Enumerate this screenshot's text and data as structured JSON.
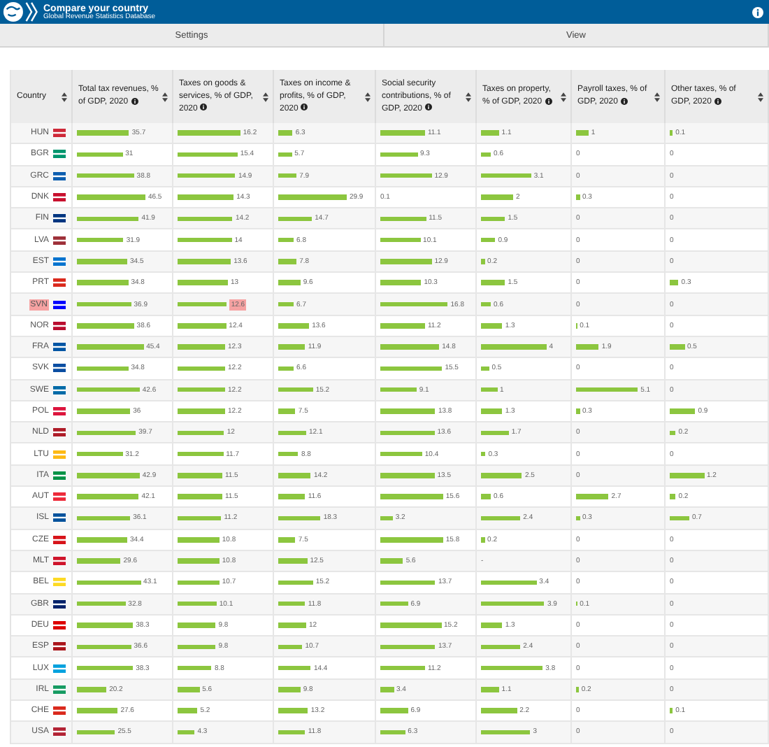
{
  "header": {
    "title": "Compare your country",
    "subtitle": "Global Revenue Statistics Database"
  },
  "tabs": [
    {
      "label": "Settings",
      "selected": false
    },
    {
      "label": "View",
      "selected": false
    }
  ],
  "table": {
    "columns": [
      {
        "label": "Country",
        "info": false
      },
      {
        "label": "Total tax revenues, % of GDP, 2020",
        "info": true
      },
      {
        "label": "Taxes on goods & services, % of GDP, 2020",
        "info": true
      },
      {
        "label": "Taxes on income & profits, % of GDP, 2020",
        "info": true
      },
      {
        "label": "Social security contributions, % of GDP, 2020",
        "info": true
      },
      {
        "label": "Taxes on property, % of GDP, 2020",
        "info": true
      },
      {
        "label": "Payroll taxes, % of GDP, 2020",
        "info": true
      },
      {
        "label": "Other taxes, % of GDP, 2020",
        "info": true
      }
    ],
    "rows": [
      {
        "cells": [
          {
            "kind": "country",
            "value": "HUN",
            "highlighted": false,
            "color": "#ce2939"
          },
          {
            "kind": "bar",
            "value": "35.7",
            "level": 0.55
          },
          {
            "kind": "bar",
            "value": "16.2",
            "level": 0.66
          },
          {
            "kind": "bar",
            "value": "6.3",
            "level": 0.15
          },
          {
            "kind": "bar",
            "value": "11.1",
            "level": 0.47
          },
          {
            "kind": "bar",
            "value": "1.1",
            "level": 0.2
          },
          {
            "kind": "bar",
            "value": "1",
            "level": 0.14
          },
          {
            "kind": "bar",
            "value": "0.1",
            "level": 0.03
          }
        ]
      },
      {
        "cells": [
          {
            "kind": "country",
            "value": "BGR",
            "highlighted": false,
            "color": "#00966e"
          },
          {
            "kind": "bar",
            "value": "31",
            "level": 0.48
          },
          {
            "kind": "bar",
            "value": "15.4",
            "level": 0.63
          },
          {
            "kind": "bar",
            "value": "5.7",
            "level": 0.14
          },
          {
            "kind": "bar",
            "value": "9.3",
            "level": 0.39
          },
          {
            "kind": "bar",
            "value": "0.6",
            "level": 0.11
          },
          {
            "kind": "bar",
            "value": "0",
            "level": 0
          },
          {
            "kind": "bar",
            "value": "0",
            "level": 0
          }
        ]
      },
      {
        "cells": [
          {
            "kind": "country",
            "value": "GRC",
            "highlighted": false,
            "color": "#0d5eaf"
          },
          {
            "kind": "bar",
            "value": "38.8",
            "level": 0.6
          },
          {
            "kind": "bar",
            "value": "14.9",
            "level": 0.61
          },
          {
            "kind": "bar",
            "value": "7.9",
            "level": 0.19
          },
          {
            "kind": "bar",
            "value": "12.9",
            "level": 0.54
          },
          {
            "kind": "bar",
            "value": "3.1",
            "level": 0.56
          },
          {
            "kind": "bar",
            "value": "0",
            "level": 0
          },
          {
            "kind": "bar",
            "value": "0",
            "level": 0
          }
        ]
      },
      {
        "cells": [
          {
            "kind": "country",
            "value": "DNK",
            "highlighted": false,
            "color": "#c8102e"
          },
          {
            "kind": "bar",
            "value": "46.5",
            "level": 0.72
          },
          {
            "kind": "bar",
            "value": "14.3",
            "level": 0.59
          },
          {
            "kind": "bar",
            "value": "29.9",
            "level": 0.71
          },
          {
            "kind": "bar",
            "value": "0.1",
            "level": 0
          },
          {
            "kind": "bar",
            "value": "2",
            "level": 0.36
          },
          {
            "kind": "bar",
            "value": "0.3",
            "level": 0.04
          },
          {
            "kind": "bar",
            "value": "0",
            "level": 0
          }
        ]
      },
      {
        "cells": [
          {
            "kind": "country",
            "value": "FIN",
            "highlighted": false,
            "color": "#003580"
          },
          {
            "kind": "bar",
            "value": "41.9",
            "level": 0.65
          },
          {
            "kind": "bar",
            "value": "14.2",
            "level": 0.58
          },
          {
            "kind": "bar",
            "value": "14.7",
            "level": 0.35
          },
          {
            "kind": "bar",
            "value": "11.5",
            "level": 0.48
          },
          {
            "kind": "bar",
            "value": "1.5",
            "level": 0.27
          },
          {
            "kind": "bar",
            "value": "0",
            "level": 0
          },
          {
            "kind": "bar",
            "value": "0",
            "level": 0
          }
        ]
      },
      {
        "cells": [
          {
            "kind": "country",
            "value": "LVA",
            "highlighted": false,
            "color": "#9e3039"
          },
          {
            "kind": "bar",
            "value": "31.9",
            "level": 0.49
          },
          {
            "kind": "bar",
            "value": "14",
            "level": 0.57
          },
          {
            "kind": "bar",
            "value": "6.8",
            "level": 0.16
          },
          {
            "kind": "bar",
            "value": "10.1",
            "level": 0.42
          },
          {
            "kind": "bar",
            "value": "0.9",
            "level": 0.16
          },
          {
            "kind": "bar",
            "value": "0",
            "level": 0
          },
          {
            "kind": "bar",
            "value": "0",
            "level": 0
          }
        ]
      },
      {
        "cells": [
          {
            "kind": "country",
            "value": "EST",
            "highlighted": false,
            "color": "#0072ce"
          },
          {
            "kind": "bar",
            "value": "34.5",
            "level": 0.53
          },
          {
            "kind": "bar",
            "value": "13.6",
            "level": 0.56
          },
          {
            "kind": "bar",
            "value": "7.8",
            "level": 0.19
          },
          {
            "kind": "bar",
            "value": "12.9",
            "level": 0.54
          },
          {
            "kind": "bar",
            "value": "0.2",
            "level": 0.04
          },
          {
            "kind": "bar",
            "value": "0",
            "level": 0
          },
          {
            "kind": "bar",
            "value": "0",
            "level": 0
          }
        ]
      },
      {
        "cells": [
          {
            "kind": "country",
            "value": "PRT",
            "highlighted": false,
            "color": "#da291c"
          },
          {
            "kind": "bar",
            "value": "34.8",
            "level": 0.54
          },
          {
            "kind": "bar",
            "value": "13",
            "level": 0.53
          },
          {
            "kind": "bar",
            "value": "9.6",
            "level": 0.23
          },
          {
            "kind": "bar",
            "value": "10.3",
            "level": 0.43
          },
          {
            "kind": "bar",
            "value": "1.5",
            "level": 0.27
          },
          {
            "kind": "bar",
            "value": "0",
            "level": 0
          },
          {
            "kind": "bar",
            "value": "0.3",
            "level": 0.09
          }
        ]
      },
      {
        "cells": [
          {
            "kind": "country",
            "value": "SVN",
            "highlighted": true,
            "color": "#0000ff"
          },
          {
            "kind": "bar",
            "value": "36.9",
            "level": 0.57
          },
          {
            "kind": "bar",
            "value": "12.6",
            "level": 0.52,
            "highlighted": true
          },
          {
            "kind": "bar",
            "value": "6.7",
            "level": 0.16
          },
          {
            "kind": "bar",
            "value": "16.8",
            "level": 0.71
          },
          {
            "kind": "bar",
            "value": "0.6",
            "level": 0.11
          },
          {
            "kind": "bar",
            "value": "0",
            "level": 0
          },
          {
            "kind": "bar",
            "value": "0",
            "level": 0
          }
        ]
      },
      {
        "cells": [
          {
            "kind": "country",
            "value": "NOR",
            "highlighted": false,
            "color": "#ba0c2f"
          },
          {
            "kind": "bar",
            "value": "38.6",
            "level": 0.6
          },
          {
            "kind": "bar",
            "value": "12.4",
            "level": 0.51
          },
          {
            "kind": "bar",
            "value": "13.6",
            "level": 0.32
          },
          {
            "kind": "bar",
            "value": "11.2",
            "level": 0.47
          },
          {
            "kind": "bar",
            "value": "1.3",
            "level": 0.24
          },
          {
            "kind": "bar",
            "value": "0.1",
            "level": 0.01
          },
          {
            "kind": "bar",
            "value": "0",
            "level": 0
          }
        ]
      },
      {
        "cells": [
          {
            "kind": "country",
            "value": "FRA",
            "highlighted": false,
            "color": "#0055a4"
          },
          {
            "kind": "bar",
            "value": "45.4",
            "level": 0.7
          },
          {
            "kind": "bar",
            "value": "12.3",
            "level": 0.5
          },
          {
            "kind": "bar",
            "value": "11.9",
            "level": 0.28
          },
          {
            "kind": "bar",
            "value": "14.8",
            "level": 0.62
          },
          {
            "kind": "bar",
            "value": "4",
            "level": 0.73
          },
          {
            "kind": "bar",
            "value": "1.9",
            "level": 0.26
          },
          {
            "kind": "bar",
            "value": "0.5",
            "level": 0.15
          }
        ]
      },
      {
        "cells": [
          {
            "kind": "country",
            "value": "SVK",
            "highlighted": false,
            "color": "#0b4ea2"
          },
          {
            "kind": "bar",
            "value": "34.8",
            "level": 0.54
          },
          {
            "kind": "bar",
            "value": "12.2",
            "level": 0.5
          },
          {
            "kind": "bar",
            "value": "6.6",
            "level": 0.16
          },
          {
            "kind": "bar",
            "value": "15.5",
            "level": 0.65
          },
          {
            "kind": "bar",
            "value": "0.5",
            "level": 0.09
          },
          {
            "kind": "bar",
            "value": "0",
            "level": 0
          },
          {
            "kind": "bar",
            "value": "0",
            "level": 0
          }
        ]
      },
      {
        "cells": [
          {
            "kind": "country",
            "value": "SWE",
            "highlighted": false,
            "color": "#006aa7"
          },
          {
            "kind": "bar",
            "value": "42.6",
            "level": 0.66
          },
          {
            "kind": "bar",
            "value": "12.2",
            "level": 0.5
          },
          {
            "kind": "bar",
            "value": "15.2",
            "level": 0.36
          },
          {
            "kind": "bar",
            "value": "9.1",
            "level": 0.38
          },
          {
            "kind": "bar",
            "value": "1",
            "level": 0.18
          },
          {
            "kind": "bar",
            "value": "5.1",
            "level": 0.7
          },
          {
            "kind": "bar",
            "value": "0",
            "level": 0
          }
        ]
      },
      {
        "cells": [
          {
            "kind": "country",
            "value": "POL",
            "highlighted": false,
            "color": "#dc143c"
          },
          {
            "kind": "bar",
            "value": "36",
            "level": 0.56
          },
          {
            "kind": "bar",
            "value": "12.2",
            "level": 0.5
          },
          {
            "kind": "bar",
            "value": "7.5",
            "level": 0.18
          },
          {
            "kind": "bar",
            "value": "13.8",
            "level": 0.58
          },
          {
            "kind": "bar",
            "value": "1.3",
            "level": 0.24
          },
          {
            "kind": "bar",
            "value": "0.3",
            "level": 0.04
          },
          {
            "kind": "bar",
            "value": "0.9",
            "level": 0.26
          }
        ]
      },
      {
        "cells": [
          {
            "kind": "country",
            "value": "NLD",
            "highlighted": false,
            "color": "#ae1c28"
          },
          {
            "kind": "bar",
            "value": "39.7",
            "level": 0.62
          },
          {
            "kind": "bar",
            "value": "12",
            "level": 0.49
          },
          {
            "kind": "bar",
            "value": "12.1",
            "level": 0.29
          },
          {
            "kind": "bar",
            "value": "13.6",
            "level": 0.57
          },
          {
            "kind": "bar",
            "value": "1.7",
            "level": 0.31
          },
          {
            "kind": "bar",
            "value": "0",
            "level": 0
          },
          {
            "kind": "bar",
            "value": "0.2",
            "level": 0.06
          }
        ]
      },
      {
        "cells": [
          {
            "kind": "country",
            "value": "LTU",
            "highlighted": false,
            "color": "#fdb913"
          },
          {
            "kind": "bar",
            "value": "31.2",
            "level": 0.48
          },
          {
            "kind": "bar",
            "value": "11.7",
            "level": 0.48
          },
          {
            "kind": "bar",
            "value": "8.8",
            "level": 0.21
          },
          {
            "kind": "bar",
            "value": "10.4",
            "level": 0.44
          },
          {
            "kind": "bar",
            "value": "0.3",
            "level": 0.05
          },
          {
            "kind": "bar",
            "value": "0",
            "level": 0
          },
          {
            "kind": "bar",
            "value": "0",
            "level": 0
          }
        ]
      },
      {
        "cells": [
          {
            "kind": "country",
            "value": "ITA",
            "highlighted": false,
            "color": "#009246"
          },
          {
            "kind": "bar",
            "value": "42.9",
            "level": 0.66
          },
          {
            "kind": "bar",
            "value": "11.5",
            "level": 0.47
          },
          {
            "kind": "bar",
            "value": "14.2",
            "level": 0.34
          },
          {
            "kind": "bar",
            "value": "13.5",
            "level": 0.57
          },
          {
            "kind": "bar",
            "value": "2.5",
            "level": 0.46
          },
          {
            "kind": "bar",
            "value": "0",
            "level": 0
          },
          {
            "kind": "bar",
            "value": "1.2",
            "level": 0.35
          }
        ]
      },
      {
        "cells": [
          {
            "kind": "country",
            "value": "AUT",
            "highlighted": false,
            "color": "#ed2939"
          },
          {
            "kind": "bar",
            "value": "42.1",
            "level": 0.65
          },
          {
            "kind": "bar",
            "value": "11.5",
            "level": 0.47
          },
          {
            "kind": "bar",
            "value": "11.6",
            "level": 0.28
          },
          {
            "kind": "bar",
            "value": "15.6",
            "level": 0.66
          },
          {
            "kind": "bar",
            "value": "0.6",
            "level": 0.11
          },
          {
            "kind": "bar",
            "value": "2.7",
            "level": 0.37
          },
          {
            "kind": "bar",
            "value": "0.2",
            "level": 0.06
          }
        ]
      },
      {
        "cells": [
          {
            "kind": "country",
            "value": "ISL",
            "highlighted": false,
            "color": "#02529c"
          },
          {
            "kind": "bar",
            "value": "36.1",
            "level": 0.56
          },
          {
            "kind": "bar",
            "value": "11.2",
            "level": 0.46
          },
          {
            "kind": "bar",
            "value": "18.3",
            "level": 0.44
          },
          {
            "kind": "bar",
            "value": "3.2",
            "level": 0.13
          },
          {
            "kind": "bar",
            "value": "2.4",
            "level": 0.44
          },
          {
            "kind": "bar",
            "value": "0.3",
            "level": 0.04
          },
          {
            "kind": "bar",
            "value": "0.7",
            "level": 0.2
          }
        ]
      },
      {
        "cells": [
          {
            "kind": "country",
            "value": "CZE",
            "highlighted": false,
            "color": "#d7141a"
          },
          {
            "kind": "bar",
            "value": "34.4",
            "level": 0.53
          },
          {
            "kind": "bar",
            "value": "10.8",
            "level": 0.44
          },
          {
            "kind": "bar",
            "value": "7.5",
            "level": 0.18
          },
          {
            "kind": "bar",
            "value": "15.8",
            "level": 0.66
          },
          {
            "kind": "bar",
            "value": "0.2",
            "level": 0.04
          },
          {
            "kind": "bar",
            "value": "0",
            "level": 0
          },
          {
            "kind": "bar",
            "value": "0",
            "level": 0
          }
        ]
      },
      {
        "cells": [
          {
            "kind": "country",
            "value": "MLT",
            "highlighted": false,
            "color": "#cf142b"
          },
          {
            "kind": "bar",
            "value": "29.6",
            "level": 0.46
          },
          {
            "kind": "bar",
            "value": "10.8",
            "level": 0.44
          },
          {
            "kind": "bar",
            "value": "12.5",
            "level": 0.3
          },
          {
            "kind": "bar",
            "value": "5.6",
            "level": 0.24
          },
          {
            "kind": "bar",
            "value": "-",
            "level": 0
          },
          {
            "kind": "bar",
            "value": "0",
            "level": 0
          },
          {
            "kind": "bar",
            "value": "0",
            "level": 0
          }
        ]
      },
      {
        "cells": [
          {
            "kind": "country",
            "value": "BEL",
            "highlighted": false,
            "color": "#fdda24"
          },
          {
            "kind": "bar",
            "value": "43.1",
            "level": 0.67
          },
          {
            "kind": "bar",
            "value": "10.7",
            "level": 0.44
          },
          {
            "kind": "bar",
            "value": "15.2",
            "level": 0.36
          },
          {
            "kind": "bar",
            "value": "13.7",
            "level": 0.58
          },
          {
            "kind": "bar",
            "value": "3.4",
            "level": 0.62
          },
          {
            "kind": "bar",
            "value": "0",
            "level": 0
          },
          {
            "kind": "bar",
            "value": "0",
            "level": 0
          }
        ]
      },
      {
        "cells": [
          {
            "kind": "country",
            "value": "GBR",
            "highlighted": false,
            "color": "#012169"
          },
          {
            "kind": "bar",
            "value": "32.8",
            "level": 0.51
          },
          {
            "kind": "bar",
            "value": "10.1",
            "level": 0.41
          },
          {
            "kind": "bar",
            "value": "11.8",
            "level": 0.28
          },
          {
            "kind": "bar",
            "value": "6.9",
            "level": 0.29
          },
          {
            "kind": "bar",
            "value": "3.9",
            "level": 0.71
          },
          {
            "kind": "bar",
            "value": "0.1",
            "level": 0.01
          },
          {
            "kind": "bar",
            "value": "0",
            "level": 0
          }
        ]
      },
      {
        "cells": [
          {
            "kind": "country",
            "value": "DEU",
            "highlighted": false,
            "color": "#dd0000"
          },
          {
            "kind": "bar",
            "value": "38.3",
            "level": 0.59
          },
          {
            "kind": "bar",
            "value": "9.8",
            "level": 0.4
          },
          {
            "kind": "bar",
            "value": "12",
            "level": 0.29
          },
          {
            "kind": "bar",
            "value": "15.2",
            "level": 0.64
          },
          {
            "kind": "bar",
            "value": "1.3",
            "level": 0.24
          },
          {
            "kind": "bar",
            "value": "0",
            "level": 0
          },
          {
            "kind": "bar",
            "value": "0",
            "level": 0
          }
        ]
      },
      {
        "cells": [
          {
            "kind": "country",
            "value": "ESP",
            "highlighted": false,
            "color": "#aa151b"
          },
          {
            "kind": "bar",
            "value": "36.6",
            "level": 0.57
          },
          {
            "kind": "bar",
            "value": "9.8",
            "level": 0.4
          },
          {
            "kind": "bar",
            "value": "10.7",
            "level": 0.25
          },
          {
            "kind": "bar",
            "value": "13.7",
            "level": 0.58
          },
          {
            "kind": "bar",
            "value": "2.4",
            "level": 0.44
          },
          {
            "kind": "bar",
            "value": "0",
            "level": 0
          },
          {
            "kind": "bar",
            "value": "0",
            "level": 0
          }
        ]
      },
      {
        "cells": [
          {
            "kind": "country",
            "value": "LUX",
            "highlighted": false,
            "color": "#00a1de"
          },
          {
            "kind": "bar",
            "value": "38.3",
            "level": 0.59
          },
          {
            "kind": "bar",
            "value": "8.8",
            "level": 0.36
          },
          {
            "kind": "bar",
            "value": "14.4",
            "level": 0.34
          },
          {
            "kind": "bar",
            "value": "11.2",
            "level": 0.47
          },
          {
            "kind": "bar",
            "value": "3.8",
            "level": 0.69
          },
          {
            "kind": "bar",
            "value": "0",
            "level": 0
          },
          {
            "kind": "bar",
            "value": "0",
            "level": 0
          }
        ]
      },
      {
        "cells": [
          {
            "kind": "country",
            "value": "IRL",
            "highlighted": false,
            "color": "#169b62"
          },
          {
            "kind": "bar",
            "value": "20.2",
            "level": 0.31
          },
          {
            "kind": "bar",
            "value": "5.6",
            "level": 0.23
          },
          {
            "kind": "bar",
            "value": "9.8",
            "level": 0.23
          },
          {
            "kind": "bar",
            "value": "3.4",
            "level": 0.14
          },
          {
            "kind": "bar",
            "value": "1.1",
            "level": 0.2
          },
          {
            "kind": "bar",
            "value": "0.2",
            "level": 0.03
          },
          {
            "kind": "bar",
            "value": "0",
            "level": 0
          }
        ]
      },
      {
        "cells": [
          {
            "kind": "country",
            "value": "CHE",
            "highlighted": false,
            "color": "#da291c"
          },
          {
            "kind": "bar",
            "value": "27.6",
            "level": 0.43
          },
          {
            "kind": "bar",
            "value": "5.2",
            "level": 0.21
          },
          {
            "kind": "bar",
            "value": "13.2",
            "level": 0.31
          },
          {
            "kind": "bar",
            "value": "6.9",
            "level": 0.29
          },
          {
            "kind": "bar",
            "value": "2.2",
            "level": 0.4
          },
          {
            "kind": "bar",
            "value": "0",
            "level": 0
          },
          {
            "kind": "bar",
            "value": "0.1",
            "level": 0.03
          }
        ]
      },
      {
        "cells": [
          {
            "kind": "country",
            "value": "USA",
            "highlighted": false,
            "color": "#b22234"
          },
          {
            "kind": "bar",
            "value": "25.5",
            "level": 0.4
          },
          {
            "kind": "bar",
            "value": "4.3",
            "level": 0.18
          },
          {
            "kind": "bar",
            "value": "11.8",
            "level": 0.28
          },
          {
            "kind": "bar",
            "value": "6.3",
            "level": 0.26
          },
          {
            "kind": "bar",
            "value": "3",
            "level": 0.55
          },
          {
            "kind": "bar",
            "value": "0",
            "level": 0
          },
          {
            "kind": "bar",
            "value": "0",
            "level": 0
          }
        ]
      }
    ]
  }
}
